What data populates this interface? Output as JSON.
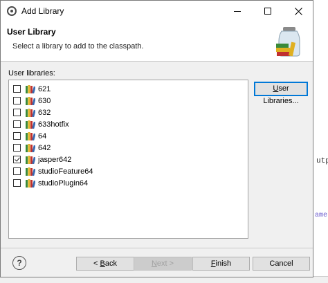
{
  "window": {
    "title": "Add Library"
  },
  "banner": {
    "title": "User Library",
    "description": "Select a library to add to the classpath."
  },
  "list": {
    "label": "User libraries:",
    "items": [
      {
        "label": "621",
        "checked": false
      },
      {
        "label": "630",
        "checked": false
      },
      {
        "label": "632",
        "checked": false
      },
      {
        "label": "633hotfix",
        "checked": false
      },
      {
        "label": "64",
        "checked": false
      },
      {
        "label": "642",
        "checked": false
      },
      {
        "label": "jasper642",
        "checked": true
      },
      {
        "label": "studioFeature64",
        "checked": false
      },
      {
        "label": "studioPlugin64",
        "checked": false
      }
    ]
  },
  "buttons": {
    "user_libraries_prefix": "U",
    "user_libraries_rest": "ser Libraries...",
    "back_prefix": "< ",
    "back_mnemonic": "B",
    "back_rest": "ack",
    "next_mnemonic": "N",
    "next_rest": "ext >",
    "finish_mnemonic": "F",
    "finish_rest": "inish",
    "cancel": "Cancel",
    "help": "?"
  },
  "background": {
    "fragment1": "utp",
    "fragment2": "ame"
  },
  "colors": {
    "focus_border": "#0078d7",
    "dialog_bg": "#f0f0f0",
    "book_green": "#3a8a3a",
    "book_yellow": "#e0b020",
    "book_red": "#c03030"
  },
  "icons": {
    "app": "eclipse-icon",
    "library": "library-books-icon",
    "banner": "library-jar-icon"
  }
}
